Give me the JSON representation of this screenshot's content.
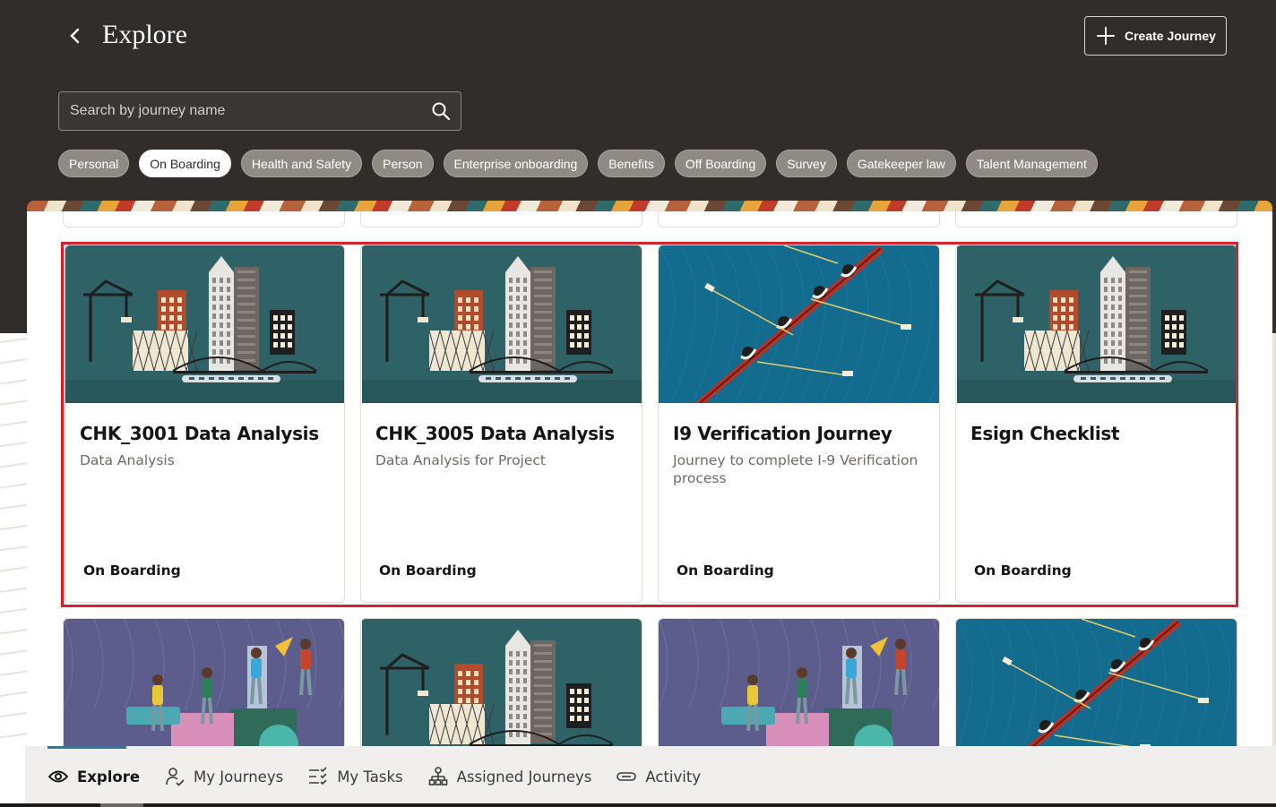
{
  "header": {
    "title": "Explore",
    "create_label": "Create Journey",
    "search_placeholder": "Search by journey name"
  },
  "chips": [
    {
      "label": "Personal",
      "selected": false
    },
    {
      "label": "On Boarding",
      "selected": true
    },
    {
      "label": "Health and Safety",
      "selected": false
    },
    {
      "label": "Person",
      "selected": false
    },
    {
      "label": "Enterprise onboarding",
      "selected": false
    },
    {
      "label": "Benefits",
      "selected": false
    },
    {
      "label": "Off Boarding",
      "selected": false
    },
    {
      "label": "Survey",
      "selected": false
    },
    {
      "label": "Gatekeeper law",
      "selected": false
    },
    {
      "label": "Talent Management",
      "selected": false
    }
  ],
  "cards": [
    {
      "title": "CHK_3001 Data Analysis",
      "subtitle": "Data Analysis",
      "category": "On Boarding",
      "image": "city-illustration"
    },
    {
      "title": "CHK_3005 Data Analysis",
      "subtitle": "Data Analysis for Project",
      "category": "On Boarding",
      "image": "city-illustration"
    },
    {
      "title": "I9 Verification Journey",
      "subtitle": "Journey to complete I-9 Verification process",
      "category": "On Boarding",
      "image": "rowing-illustration"
    },
    {
      "title": "Esign Checklist",
      "subtitle": "",
      "category": "On Boarding",
      "image": "city-illustration"
    }
  ],
  "next_cards": [
    {
      "image": "team-illustration"
    },
    {
      "image": "city-illustration"
    },
    {
      "image": "team-illustration"
    },
    {
      "image": "rowing-illustration"
    }
  ],
  "nav": [
    {
      "label": "Explore",
      "icon": "eye-icon",
      "active": true
    },
    {
      "label": "My Journeys",
      "icon": "person-check-icon",
      "active": false
    },
    {
      "label": "My Tasks",
      "icon": "checklist-icon",
      "active": false
    },
    {
      "label": "Assigned Journeys",
      "icon": "hierarchy-icon",
      "active": false
    },
    {
      "label": "Activity",
      "icon": "link-icon",
      "active": false
    }
  ],
  "colors": {
    "header_bg": "#312d2a",
    "highlight": "#d7202b",
    "nav_accent": "#227e9e",
    "city_bg": "#2f6266",
    "rowing_bg": "#136b8e",
    "team_bg": "#5c5d8c"
  }
}
